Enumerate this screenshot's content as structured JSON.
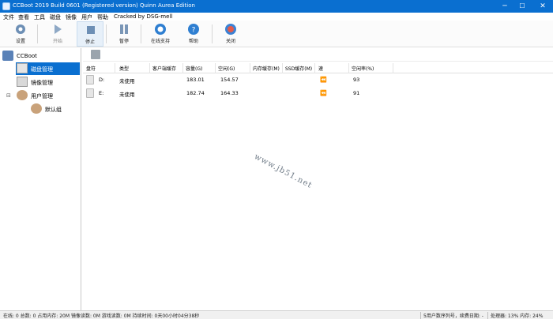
{
  "window": {
    "title": "CCBoot 2019 Build 0601 (Registered version) Quinn Aurea Edition",
    "controls": {
      "minimize": "─",
      "maximize": "☐",
      "close": "✕"
    }
  },
  "menu": [
    "文件",
    "查看",
    "工具",
    "磁盘",
    "镜像",
    "用户",
    "帮助",
    "Cracked by DSG-mell"
  ],
  "toolbar": {
    "settings": "设置",
    "start": "开始",
    "stop": "停止",
    "pause": "暂停",
    "online_support": "在线支持",
    "help": "帮助",
    "close": "关闭"
  },
  "tree": {
    "root": "CCBoot",
    "disk_mgmt": "磁盘管理",
    "image_mgmt": "镜像管理",
    "user_mgmt": "用户管理",
    "default_group": "默认组",
    "expander": "⊟"
  },
  "table": {
    "headers": [
      "盘符",
      "类型",
      "客户端缓存",
      "容量(G)",
      "空闲(G)",
      "内存缓存(M)",
      "SSD缓存(M)",
      "速",
      "空闲率(%)"
    ],
    "rows": [
      {
        "drive": "D:",
        "type": "未使用",
        "capacity": "183.01",
        "free": "154.57",
        "speed": "⏪",
        "free_rate": "93"
      },
      {
        "drive": "E:",
        "type": "未使用",
        "capacity": "182.74",
        "free": "164.33",
        "speed": "⏪",
        "free_rate": "91"
      }
    ]
  },
  "watermark": "www.jb51.net",
  "status": {
    "left": "在线: 0 总数: 0 占用内存: 20M 镜像读数: 0M 游戏读数: 0M 持续时间: 0天00小时04分38秒",
    "license": "5用户数序列号，续费日期: -",
    "cpu": "处理器: 13% 内存: 24%"
  },
  "colors": {
    "accent": "#0a6fd0",
    "selected_row": "#0a6fd0"
  }
}
